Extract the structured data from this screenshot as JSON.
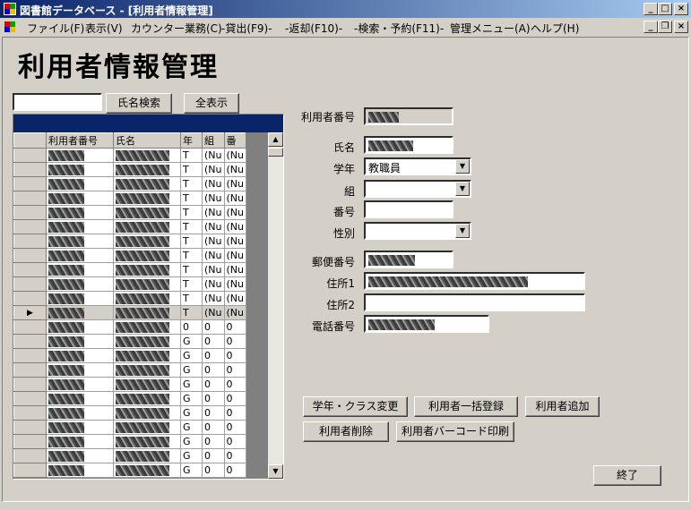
{
  "window": {
    "title": "図書館データベース - [利用者情報管理]",
    "min": "_",
    "max": "□",
    "close": "×",
    "restore": "❐"
  },
  "menu": [
    "ファイル(F)",
    "表示(V)",
    "カウンター業務(C)",
    "-貸出(F9)-",
    "-返却(F10)-",
    "-検索・予約(F11)-",
    "管理メニュー(A)",
    "ヘルプ(H)"
  ],
  "heading": "利用者情報管理",
  "search": {
    "value": "",
    "search_btn": "氏名検索",
    "show_all_btn": "全表示"
  },
  "grid": {
    "columns": [
      "利用者番号",
      "氏名",
      "年",
      "組",
      "番"
    ],
    "rows": [
      [
        "T",
        "(Nu",
        "(Nu"
      ],
      [
        "T",
        "(Nu",
        "(Nu"
      ],
      [
        "T",
        "(Nu",
        "(Nu"
      ],
      [
        "T",
        "(Nu",
        "(Nu"
      ],
      [
        "T",
        "(Nu",
        "(Nu"
      ],
      [
        "T",
        "(Nu",
        "(Nu"
      ],
      [
        "T",
        "(Nu",
        "(Nu"
      ],
      [
        "T",
        "(Nu",
        "(Nu"
      ],
      [
        "T",
        "(Nu",
        "(Nu"
      ],
      [
        "T",
        "(Nu",
        "(Nu"
      ],
      [
        "T",
        "(Nu",
        "(Nu"
      ],
      [
        "T",
        "(Nu",
        "(Nu"
      ],
      [
        "0",
        "0",
        "0"
      ],
      [
        "G",
        "0",
        "0"
      ],
      [
        "G",
        "0",
        "0"
      ],
      [
        "G",
        "0",
        "0"
      ],
      [
        "G",
        "0",
        "0"
      ],
      [
        "G",
        "0",
        "0"
      ],
      [
        "G",
        "0",
        "0"
      ],
      [
        "G",
        "0",
        "0"
      ],
      [
        "G",
        "0",
        "0"
      ],
      [
        "G",
        "0",
        "0"
      ],
      [
        "G",
        "0",
        "0"
      ]
    ],
    "current_row_marker": "▶",
    "current_row_index": 11,
    "scroll_up": "▲",
    "scroll_down": "▼"
  },
  "form": {
    "user_no_label": "利用者番号",
    "name_label": "氏名",
    "grade_label": "学年",
    "grade_value": "教職員",
    "class_label": "組",
    "number_label": "番号",
    "gender_label": "性別",
    "postal_label": "郵便番号",
    "address1_label": "住所1",
    "address2_label": "住所2",
    "phone_label": "電話番号",
    "dropdown_arrow": "▼"
  },
  "actions": {
    "change_class": "学年・クラス変更",
    "bulk_register": "利用者一括登録",
    "add_user": "利用者追加",
    "delete_user": "利用者削除",
    "print_barcode": "利用者バーコード印刷",
    "exit": "終了"
  }
}
